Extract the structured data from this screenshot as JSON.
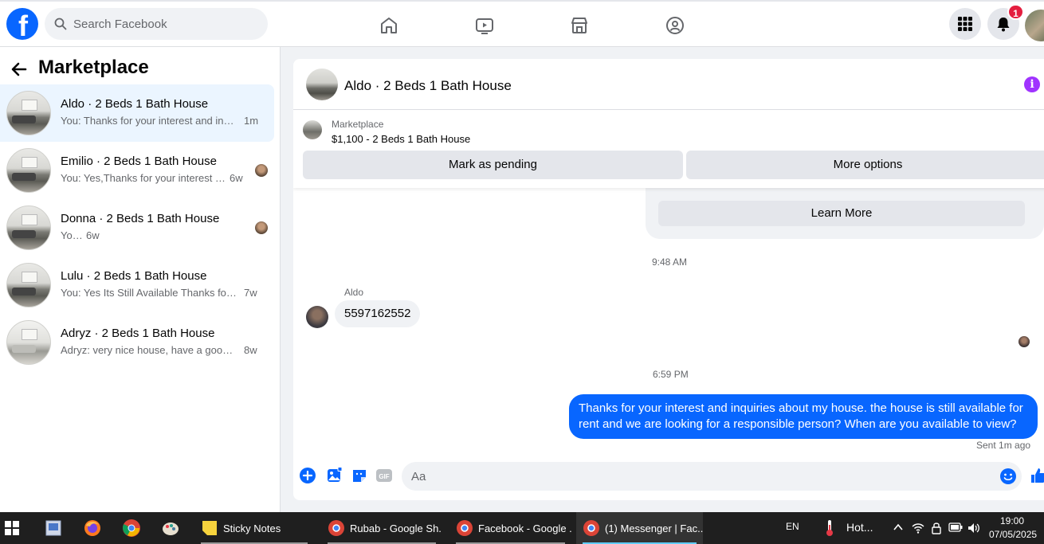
{
  "header": {
    "search_placeholder": "Search Facebook",
    "notification_count": "1",
    "nav_icons": [
      "home-icon",
      "watch-icon",
      "marketplace-icon",
      "groups-icon"
    ],
    "right_icons": [
      "menu-grid-icon",
      "bell-icon"
    ]
  },
  "sidebar": {
    "title": "Marketplace",
    "conversations": [
      {
        "name": "Aldo · 2 Beds 1 Bath House",
        "snippet": "You: Thanks for your interest and inq...",
        "time": "1m",
        "active": true
      },
      {
        "name": "Emilio · 2 Beds 1 Bath House",
        "snippet": "You: Yes,Thanks for your interest in...",
        "time": "6w",
        "active": false
      },
      {
        "name": "Donna · 2 Beds 1 Bath House",
        "snippet": "You: ?",
        "time": "6w",
        "active": false
      },
      {
        "name": "Lulu · 2 Beds 1 Bath House",
        "snippet": "You: Yes Its Still Available Thanks for y...",
        "time": "7w",
        "active": false
      },
      {
        "name": "Adryz · 2 Beds 1 Bath House",
        "snippet": "Adryz: very nice house, have a good ...",
        "time": "8w",
        "active": false
      }
    ]
  },
  "chat": {
    "title": "Aldo · 2 Beds 1 Bath House",
    "marketplace_label": "Marketplace",
    "listing": "$1,100 - 2 Beds 1 Bath House",
    "mark_pending_label": "Mark as pending",
    "more_options_label": "More options",
    "learn_more_label": "Learn More",
    "timestamp_1": "9:48 AM",
    "sender": "Aldo",
    "incoming_message": "5597162552",
    "timestamp_2": "6:59 PM",
    "outgoing_message": "Thanks for your interest and inquiries about my house. the house is still available for rent and we are looking for a responsible person? When are you available to view?",
    "sent_status": "Sent 1m ago",
    "composer_placeholder": "Aa"
  },
  "taskbar": {
    "apps": [
      {
        "label": "Sticky Notes",
        "active": false
      },
      {
        "label": "Rubab - Google Sh...",
        "active": false
      },
      {
        "label": "Facebook - Google ...",
        "active": false
      },
      {
        "label": "(1) Messenger | Fac...",
        "active": true
      }
    ],
    "language": "EN",
    "weather": "Hot...",
    "time": "19:00",
    "date": "07/05/2025"
  },
  "colors": {
    "brand_blue": "#0866ff",
    "active_row": "#ebf5ff",
    "badge_red": "#e41e3f",
    "info_purple": "#a033ff"
  }
}
